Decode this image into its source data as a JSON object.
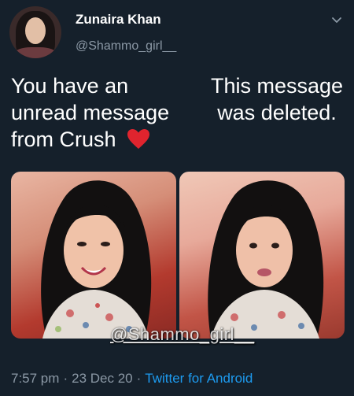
{
  "tweet": {
    "display_name": "Zunaira Khan",
    "handle": "@Shammo_girl__",
    "left_caption": "You have an unread message from Crush",
    "right_caption": "This message was deleted.",
    "watermark": "@Shammo_girl__",
    "time": "7:57 pm",
    "date": "23 Dec 20",
    "source": "Twitter for Android",
    "separator": "·"
  },
  "icons": {
    "menu": "chevron-down-icon",
    "heart": "red-heart-emoji"
  },
  "colors": {
    "background": "#15202b",
    "text": "#ffffff",
    "secondary_text": "#8b98a5",
    "link": "#1d9bf0",
    "heart": "#e0242e"
  }
}
